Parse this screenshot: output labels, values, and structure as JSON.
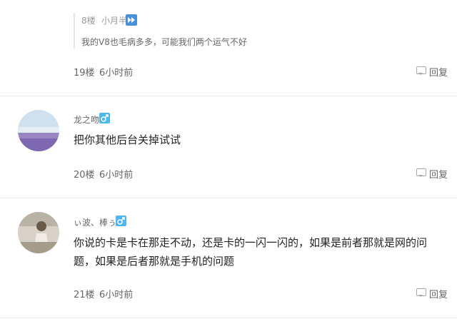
{
  "quote": {
    "floor": "8楼",
    "user": "小月半",
    "user_icon": "fast-forward-icon",
    "text": "我的V8也毛病多多，可能我们两个运气不好"
  },
  "comments": [
    {
      "floor": "19楼",
      "time": "6小时前",
      "reply_label": "回复"
    },
    {
      "floor": "20楼",
      "time": "6小时前",
      "reply_label": "回复",
      "user": "龙之吻",
      "gender": "male-icon",
      "content": "把你其他后台关掉试试"
    },
    {
      "floor": "21楼",
      "time": "6小时前",
      "reply_label": "回复",
      "user": "ぃ波、棒ぅ",
      "gender": "male-icon",
      "content_line1": "你说的卡是卡在那走不动，还是卡的一闪一闪的，如果是前者那就是网的问",
      "content_line2": "题，如果是后者那就是手机的问题"
    }
  ],
  "colors": {
    "gender_badge": "#4db8f0",
    "divider": "#e8e8e8",
    "muted_text": "#999999"
  }
}
